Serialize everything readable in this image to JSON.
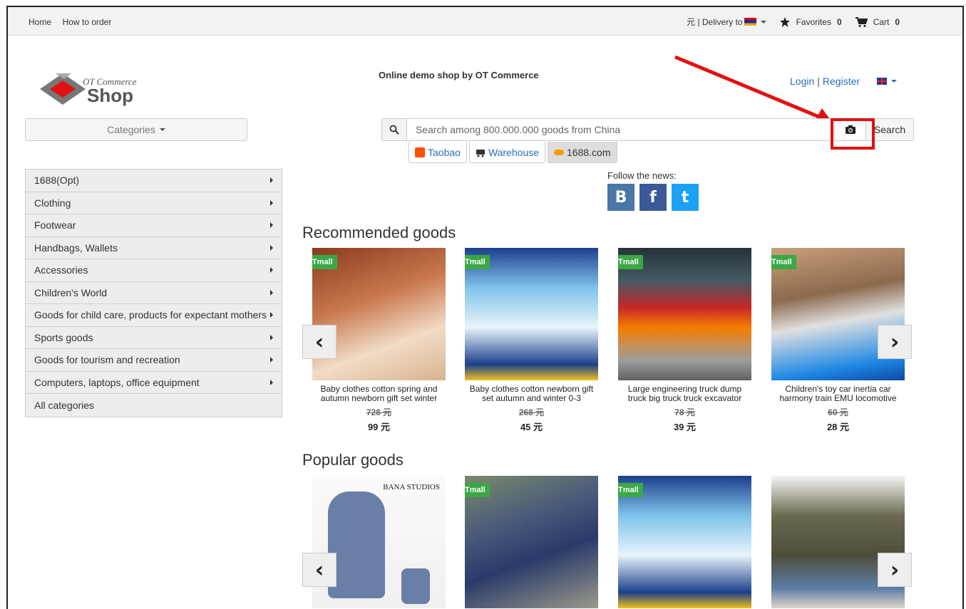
{
  "topbar": {
    "home": "Home",
    "how_to_order": "How to order",
    "currency_delivery": "元 | Delivery to",
    "favorites_label": "Favorites",
    "favorites_count": "0",
    "cart_label": "Cart",
    "cart_count": "0"
  },
  "header": {
    "logo_small": "OT Commerce",
    "logo_big": "Shop",
    "tagline": "Online demo shop by OT Commerce",
    "login": "Login",
    "sep": "|",
    "register": "Register"
  },
  "categories_button": "Categories",
  "search": {
    "placeholder": "Search among 800.000.000 goods from China",
    "button": "Search"
  },
  "providers": [
    {
      "label": "Taobao"
    },
    {
      "label": "Warehouse"
    },
    {
      "label": "1688.com"
    }
  ],
  "follow": {
    "label": "Follow the news:",
    "icons": [
      "B",
      "f",
      "t"
    ]
  },
  "sidebar": {
    "items": [
      {
        "label": "1688(Opt)"
      },
      {
        "label": "Clothing"
      },
      {
        "label": "Footwear"
      },
      {
        "label": "Handbags, Wallets"
      },
      {
        "label": "Accessories"
      },
      {
        "label": "Children's World"
      },
      {
        "label": "Goods for child care, products for expectant mothers"
      },
      {
        "label": "Sports goods"
      },
      {
        "label": "Goods for tourism and recreation"
      },
      {
        "label": "Computers, laptops, office equipment"
      },
      {
        "label": "All categories"
      }
    ]
  },
  "recommended": {
    "title": "Recommended goods",
    "badge": "Tmall",
    "items": [
      {
        "title": "Baby clothes cotton spring and autumn newborn gift set winter",
        "old": "728 元",
        "new": "99 元"
      },
      {
        "title": "Baby clothes cotton newborn gift set autumn and winter 0-3",
        "old": "268 元",
        "new": "45 元"
      },
      {
        "title": "Large engineering truck dump truck big truck truck excavator",
        "old": "78 元",
        "new": "39 元"
      },
      {
        "title": "Children's toy car inertia car harmony train EMU locomotive",
        "old": "60 元",
        "new": "28 元"
      }
    ]
  },
  "popular": {
    "title": "Popular goods",
    "badge": "Tmall",
    "img_text_1": "BANA STUDIOS"
  },
  "colors": {
    "accent": "#2a6ebb",
    "tmall": "#3aa845",
    "highlight": "#e21111"
  }
}
